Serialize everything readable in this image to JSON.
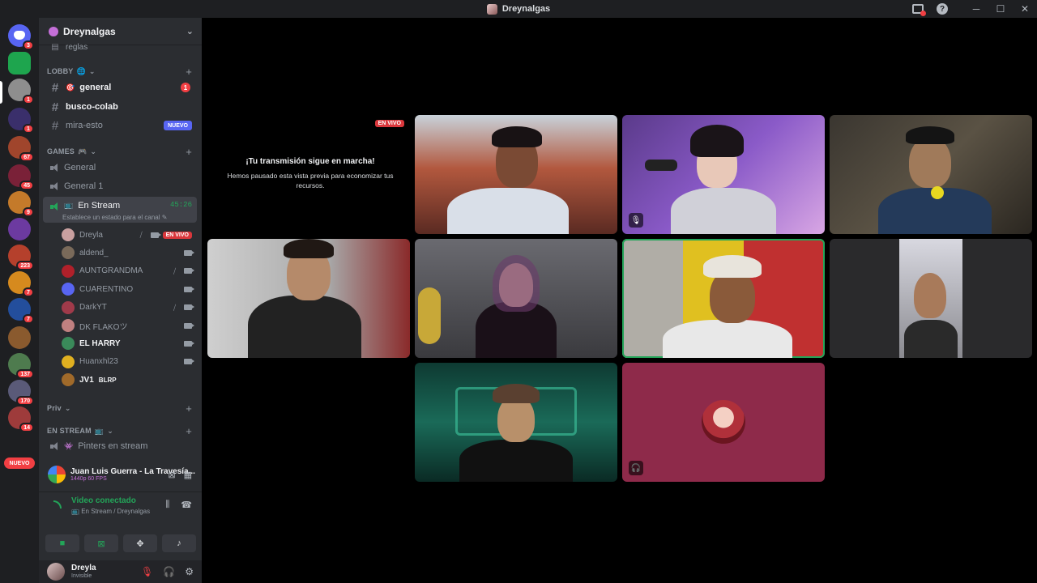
{
  "window": {
    "title": "Dreynalgas"
  },
  "servers": [
    {
      "name": "discord-home",
      "badge": "3",
      "color": "#5865f2"
    },
    {
      "name": "server-k",
      "badge": "",
      "color": "#1ea54e"
    },
    {
      "name": "server-dreynalgas",
      "badge": "1",
      "color": "#8e8e8e"
    },
    {
      "name": "server-4",
      "badge": "1",
      "color": "#3a2f6b"
    },
    {
      "name": "server-5",
      "badge": "67",
      "color": "#a0452c"
    },
    {
      "name": "server-6",
      "badge": "45",
      "color": "#7a2138"
    },
    {
      "name": "server-7",
      "badge": "9",
      "color": "#c47a2a"
    },
    {
      "name": "server-8",
      "badge": "",
      "color": "#6c3aa0"
    },
    {
      "name": "server-9",
      "badge": "223",
      "color": "#b5402c"
    },
    {
      "name": "server-10",
      "badge": "7",
      "color": "#d68a1e"
    },
    {
      "name": "server-11",
      "badge": "7",
      "color": "#234e9c"
    },
    {
      "name": "server-12",
      "badge": "",
      "color": "#8a5a2e"
    },
    {
      "name": "server-13",
      "badge": "137",
      "color": "#4e7b4e"
    },
    {
      "name": "server-14",
      "badge": "170",
      "color": "#5a5a78"
    },
    {
      "name": "server-15",
      "badge": "14",
      "color": "#9e3b3b"
    }
  ],
  "rail_nuevo": "NUEVO",
  "server_header": {
    "name": "Dreynalgas"
  },
  "partial_channel": "reglas",
  "categories": {
    "lobby": "LOBBY",
    "games": "GAMES",
    "priv": "Priv",
    "en_stream": "EN STREAM"
  },
  "text_channels": [
    {
      "name": "general",
      "mention": "1"
    },
    {
      "name": "busco-colab"
    },
    {
      "name": "mira-esto",
      "tag": "NUEVO"
    }
  ],
  "voice_channels": {
    "general": "General",
    "general1": "General 1",
    "en_stream": "En Stream",
    "en_stream_timer": "45:26",
    "en_stream_status": "Establece un estado para el canal",
    "pinters": "Pinters en stream"
  },
  "voice_users": [
    {
      "name": "Dreyla",
      "live": "EN VIVO",
      "color": "#c9a0a0"
    },
    {
      "name": "aldend_",
      "color": "#7a6a5a"
    },
    {
      "name": "AUNTGRANDMA",
      "color": "#b0202a"
    },
    {
      "name": "CUARENTINO",
      "color": "#5865f2"
    },
    {
      "name": "DarkYT",
      "color": "#a03a4a"
    },
    {
      "name": "DK FLAKOツ",
      "color": "#c08080"
    },
    {
      "name": "EL HARRY",
      "color": "#3a8a5a"
    },
    {
      "name": "Huanxhl23",
      "color": "#e0b020"
    },
    {
      "name": "JV1",
      "extra": "BLRP",
      "color": "#a06a2a"
    }
  ],
  "activity": {
    "title": "Juan Luis Guerra - La Travesía...",
    "sub": "1440p 60 FPS"
  },
  "voice_connection": {
    "title": "Video conectado",
    "sub": "En Stream / Dreynalgas"
  },
  "user": {
    "name": "Dreyla",
    "status": "Invisible"
  },
  "stage": {
    "live_tag": "EN VIVO",
    "paused_title": "¡Tu transmisión sigue en marcha!",
    "paused_text": "Hemos pausado esta vista previa para economizar tus recursos."
  }
}
